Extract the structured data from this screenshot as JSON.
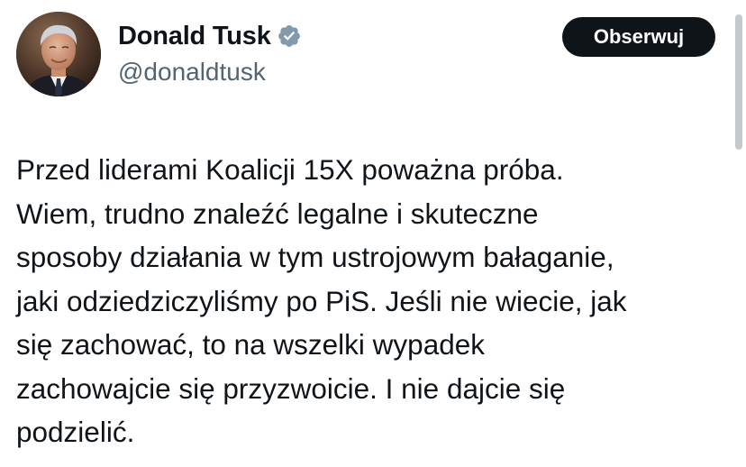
{
  "author": {
    "display_name": "Donald Tusk",
    "handle": "@donaldtusk",
    "verified_icon": "verified-badge-icon",
    "avatar_alt": "profile-photo"
  },
  "actions": {
    "follow_label": "Obserwuj"
  },
  "tweet": {
    "lines": [
      "Przed liderami Koalicji 15X poważna próba.",
      "Wiem, trudno znaleźć legalne i skuteczne",
      "sposoby działania w tym ustrojowym bałaganie,",
      "jaki odziedziczyliśmy po PiS. Jeśli nie wiecie, jak",
      "się zachować, to na wszelki wypadek",
      "zachowajcie się przyzwoicie. I nie dajcie się",
      "podzielić."
    ]
  },
  "colors": {
    "text": "#0f1419",
    "secondary_text": "#536471",
    "button_bg": "#0f1419",
    "button_text": "#ffffff",
    "verified_badge": "#829aab"
  }
}
